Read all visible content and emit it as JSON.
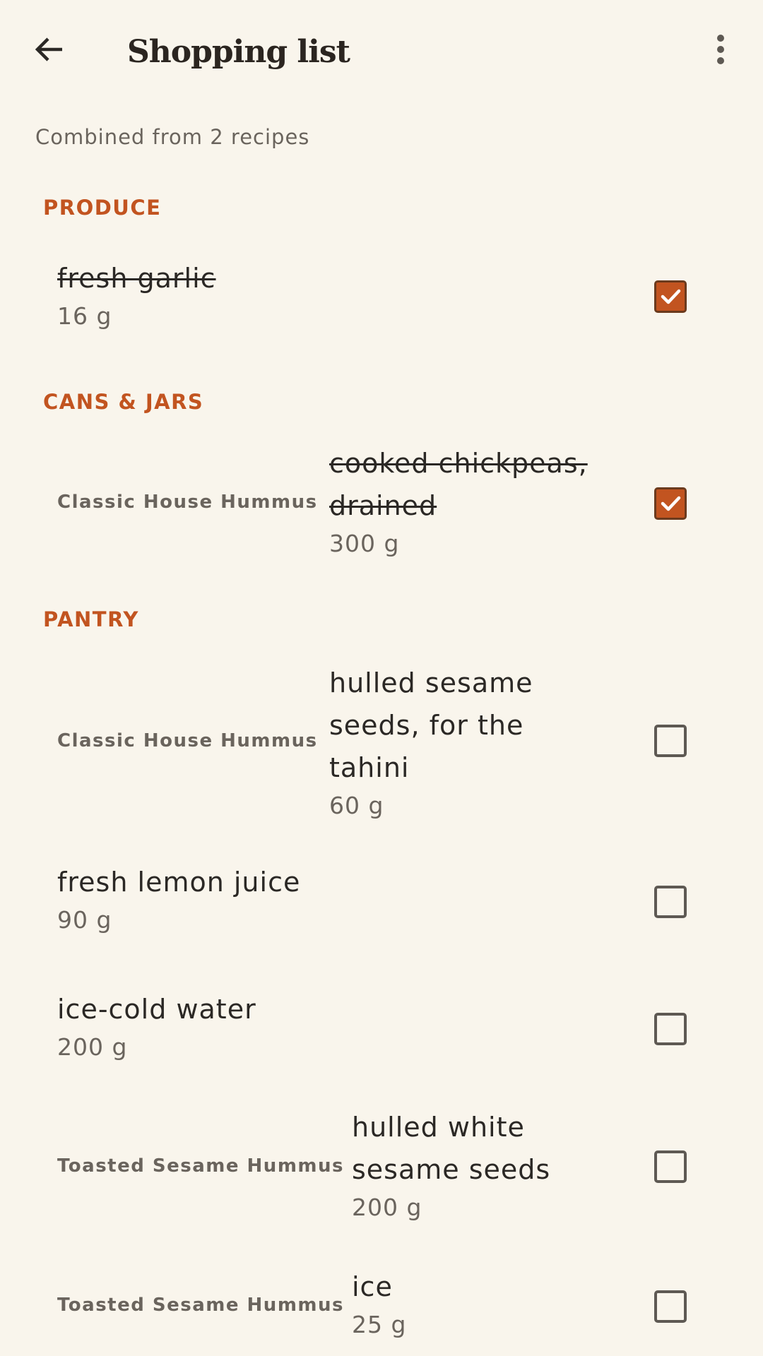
{
  "header": {
    "title": "Shopping list",
    "back_icon": "arrow-left-icon",
    "menu_icon": "more-vert-icon"
  },
  "subtitle": "Combined from 2 recipes",
  "colors": {
    "accent": "#c25420",
    "background": "#f9f5ec",
    "text": "#2b2825",
    "muted": "#6a645d"
  },
  "sections": [
    {
      "title": "PRODUCE",
      "items": [
        {
          "recipe": "",
          "name": "fresh garlic",
          "qty": "16 g",
          "checked": true
        }
      ]
    },
    {
      "title": "CANS & JARS",
      "items": [
        {
          "recipe": "Classic House Hummus",
          "name": "cooked chickpeas, drained",
          "qty": "300 g",
          "checked": true
        }
      ]
    },
    {
      "title": "PANTRY",
      "items": [
        {
          "recipe": "Classic House Hummus",
          "name": "hulled sesame seeds, for the tahini",
          "qty": "60 g",
          "checked": false
        },
        {
          "recipe": "",
          "name": "fresh lemon juice",
          "qty": "90 g",
          "checked": false
        },
        {
          "recipe": "",
          "name": "ice-cold water",
          "qty": "200 g",
          "checked": false
        },
        {
          "recipe": "Toasted Sesame Hummus",
          "name": "hulled white sesame seeds",
          "qty": "200 g",
          "checked": false
        },
        {
          "recipe": "Toasted Sesame Hummus",
          "name": "ice",
          "qty": "25 g",
          "checked": false
        }
      ]
    }
  ]
}
